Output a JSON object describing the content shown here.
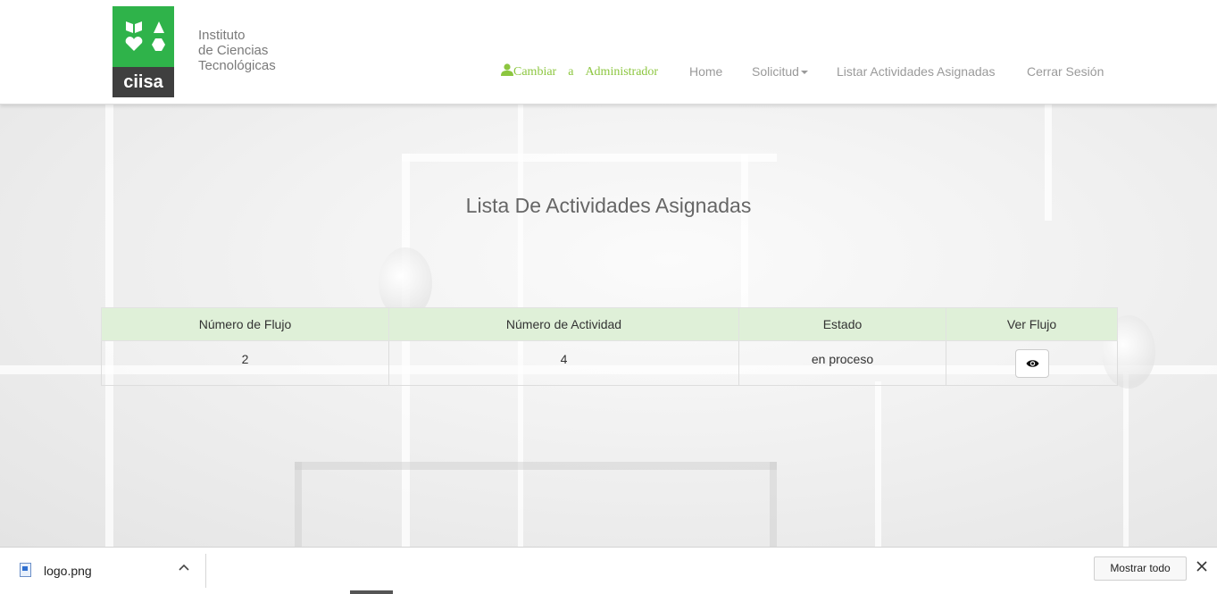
{
  "header": {
    "logo": {
      "brand_text": "ciisa",
      "name_lines": [
        "Instituto",
        "de Ciencias",
        "Tecnológicas"
      ]
    },
    "admin_link": {
      "word1": "Cambiar",
      "word2": "a",
      "word3": "Administrador",
      "icon": "user-icon"
    },
    "nav": {
      "home": "Home",
      "solicitud": "Solicitud",
      "listar": "Listar Actividades Asignadas",
      "cerrar": "Cerrar Sesión"
    }
  },
  "main": {
    "title": "Lista De Actividades Asignadas",
    "table": {
      "columns": [
        "Número de Flujo",
        "Número de Actividad",
        "Estado",
        "Ver Flujo"
      ],
      "rows": [
        {
          "flujo": "2",
          "actividad": "4",
          "estado": "en proceso",
          "ver_icon": "eye-icon"
        }
      ]
    }
  },
  "download_bar": {
    "file_name": "logo.png",
    "show_all": "Mostrar todo"
  },
  "colors": {
    "brand_green": "#2fb34a",
    "link_green": "#8cc63f",
    "table_header_bg": "#dff0d8",
    "logo_dark": "#3f3f3f"
  }
}
